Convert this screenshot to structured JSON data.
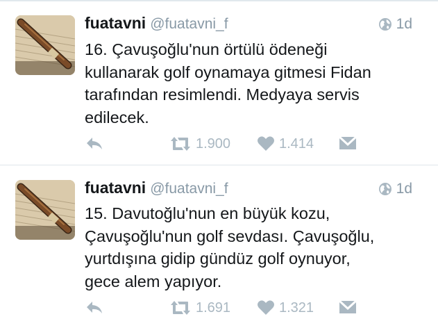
{
  "tweets": [
    {
      "name": "fuatavni",
      "handle": "@fuatavni_f",
      "time": "1d",
      "text": "16. Çavuşoğlu'nun örtülü ödeneği\nkullanarak golf oynamaya gitmesi Fidan\ntarafından resimlendi. Medyaya servis\nedilecek.",
      "retweets": "1.900",
      "likes": "1.414"
    },
    {
      "name": "fuatavni",
      "handle": "@fuatavni_f",
      "time": "1d",
      "text": "15. Davutoğlu'nun en büyük kozu,\nÇavuşoğlu'nun golf sevdası. Çavuşoğlu,\nyurtdışına gidip gündüz golf oynuyor,\ngece alem yapıyor.",
      "retweets": "1.691",
      "likes": "1.321"
    }
  ],
  "icons": {
    "avatar": "pen-on-paper-image",
    "globe": "globe-icon",
    "reply": "reply-icon",
    "retweet": "retweet-icon",
    "like": "heart-icon",
    "dm": "envelope-icon"
  },
  "colors": {
    "icon_gray": "#aab8c2",
    "handle_gray": "#8899a6",
    "text": "#14171a"
  }
}
